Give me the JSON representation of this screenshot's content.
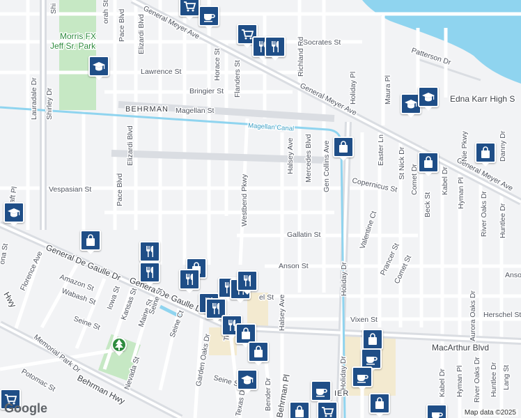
{
  "attribution": "Map data ©2025",
  "logo": "Google",
  "streets": [
    {
      "id": "general-meyer-ave-1",
      "text": "General Meyer Ave"
    },
    {
      "id": "general-meyer-ave-2",
      "text": "General Meyer Ave"
    },
    {
      "id": "general-meyer-ave-3",
      "text": "General Meyer Ave"
    },
    {
      "id": "socrates-st",
      "text": "Socrates St"
    },
    {
      "id": "patterson-dr",
      "text": "Patterson Dr"
    },
    {
      "id": "lawrence-st",
      "text": "Lawrence St"
    },
    {
      "id": "bringier-st",
      "text": "Bringier St"
    },
    {
      "id": "behrman",
      "text": "BEHRMAN"
    },
    {
      "id": "magellan-st",
      "text": "Magellan St"
    },
    {
      "id": "richland-rd",
      "text": "Richland Rd"
    },
    {
      "id": "horace-st",
      "text": "Horace St"
    },
    {
      "id": "flanders-st",
      "text": "Flanders St"
    },
    {
      "id": "pace-blvd-1",
      "text": "Pace Blvd"
    },
    {
      "id": "elizardi-blvd-1",
      "text": "Elizardi Blvd"
    },
    {
      "id": "elizardi-blvd-2",
      "text": "Elizardi Blvd"
    },
    {
      "id": "pace-blvd-2",
      "text": "Pace Blvd"
    },
    {
      "id": "shirley-dr-1",
      "text": "Shirley Dr"
    },
    {
      "id": "shirley-dr-2",
      "text": "Shi"
    },
    {
      "id": "lauradale-dr",
      "text": "Lauradale Dr"
    },
    {
      "id": "vespasian-st",
      "text": "Vespasian St"
    },
    {
      "id": "westbend-pkwy",
      "text": "Westbend Pkwy"
    },
    {
      "id": "halsey-ave-1",
      "text": "Halsey Ave"
    },
    {
      "id": "mercedes-blvd",
      "text": "Mercedes Blvd"
    },
    {
      "id": "gen-collins-ave",
      "text": "Gen Collins Ave"
    },
    {
      "id": "holiday-dr-1",
      "text": "Holiday Dr"
    },
    {
      "id": "holiday-pl",
      "text": "Holiday Pl"
    },
    {
      "id": "maura-pl",
      "text": "Maura Pl"
    },
    {
      "id": "easter-ln",
      "text": "Easter Ln"
    },
    {
      "id": "st-nick-dr",
      "text": "St Nick Dr"
    },
    {
      "id": "nie-pkwy",
      "text": "Nie Pkwy"
    },
    {
      "id": "danny-dr",
      "text": "Danny Dr"
    },
    {
      "id": "copernicus-st",
      "text": "Copernicus St"
    },
    {
      "id": "gallatin-st",
      "text": "Gallatin St"
    },
    {
      "id": "anson-st",
      "text": "Anson St"
    },
    {
      "id": "anson-st-2",
      "text": "Anso"
    },
    {
      "id": "valentine-ct",
      "text": "Valentine Ct"
    },
    {
      "id": "comet-dr",
      "text": "Comet Dr"
    },
    {
      "id": "beck-st",
      "text": "Beck St"
    },
    {
      "id": "kabel-dr-1",
      "text": "Kabel Dr"
    },
    {
      "id": "hyman-pl-1",
      "text": "Hyman Pl"
    },
    {
      "id": "river-oaks-dr-1",
      "text": "River Oaks Dr"
    },
    {
      "id": "huntlee-dr-1",
      "text": "Huntlee Dr"
    },
    {
      "id": "prancer-st",
      "text": "Prancer St"
    },
    {
      "id": "comet-st",
      "text": "Comet St"
    },
    {
      "id": "aurora-oaks-dr",
      "text": "Aurora Oaks Dr"
    },
    {
      "id": "herschel-st",
      "text": "Herschel St"
    },
    {
      "id": "vixen-st",
      "text": "Vixen St"
    },
    {
      "id": "macarthur-blvd",
      "text": "MacArthur Blvd"
    },
    {
      "id": "holiday-dr-2",
      "text": "Holiday Dr"
    },
    {
      "id": "halsey-ave-2",
      "text": "Halsey Ave"
    },
    {
      "id": "kabel-dr-2",
      "text": "Kabel Dr"
    },
    {
      "id": "hyman-pl-2",
      "text": "Hyman Pl"
    },
    {
      "id": "river-oaks-dr-2",
      "text": "River Oaks Dr"
    },
    {
      "id": "huntlee-dr-2",
      "text": "Huntlee Dr"
    },
    {
      "id": "lang-st",
      "text": "Lang St"
    },
    {
      "id": "general-de-gaulle-dr-1",
      "text": "General De Gaulle Dr"
    },
    {
      "id": "general-de-gaulle-dr-2",
      "text": "General De Gaulle Dr"
    },
    {
      "id": "florence-ave",
      "text": "Florence Ave"
    },
    {
      "id": "amazon-st",
      "text": "Amazon St"
    },
    {
      "id": "wabash-st",
      "text": "Wabash St"
    },
    {
      "id": "memorial-park-dr",
      "text": "Memorial Park Dr"
    },
    {
      "id": "iowa-st",
      "text": "Iowa St"
    },
    {
      "id": "kansas-st",
      "text": "Kansas St"
    },
    {
      "id": "maine-st",
      "text": "Maine St"
    },
    {
      "id": "seine-st-1",
      "text": "Seine St"
    },
    {
      "id": "seine-st-2",
      "text": "Seine St"
    },
    {
      "id": "seine-ct",
      "text": "Seine Ct"
    },
    {
      "id": "seine-st-3",
      "text": "Seine St"
    },
    {
      "id": "garden-oaks-dr",
      "text": "Garden Oaks Dr"
    },
    {
      "id": "nevada-st",
      "text": "Nevada St"
    },
    {
      "id": "potomac-st",
      "text": "Potomac St"
    },
    {
      "id": "behrman-hwy-1",
      "text": "Behrman Hwy"
    },
    {
      "id": "behrman-hwy-2",
      "text": "Hwy"
    },
    {
      "id": "behrman-pl",
      "text": "Behrman Pl"
    },
    {
      "id": "bender-dr",
      "text": "Bender Dr"
    },
    {
      "id": "texas-dr",
      "text": "Texas Dr"
    },
    {
      "id": "tullis-dr",
      "text": "Tullis Dr"
    },
    {
      "id": "ona-st",
      "text": "ona St"
    },
    {
      "id": "craft-pl",
      "text": "aft Pl"
    },
    {
      "id": "el-st",
      "text": "el St"
    },
    {
      "id": "ier",
      "text": "IER"
    },
    {
      "id": "orah-st",
      "text": "orah St"
    }
  ],
  "pois": [
    {
      "id": "morris-park",
      "text": "Morris FX\nJeff Sr. Park"
    },
    {
      "id": "edna-karr",
      "text": "Edna Karr High S"
    },
    {
      "id": "magellan-canal",
      "text": "Magellan Canal"
    }
  ],
  "markers": [
    {
      "type": "shop",
      "icon": "shopping-cart-icon"
    },
    {
      "type": "cafe",
      "icon": "coffee-cup-icon"
    },
    {
      "type": "shop",
      "icon": "shopping-cart-icon"
    },
    {
      "type": "food",
      "icon": "fork-knife-icon"
    },
    {
      "type": "food",
      "icon": "fork-knife-icon"
    },
    {
      "type": "school",
      "icon": "graduation-cap-icon"
    },
    {
      "type": "school",
      "icon": "graduation-cap-icon"
    },
    {
      "type": "school",
      "icon": "graduation-cap-icon"
    },
    {
      "type": "shopping",
      "icon": "shopping-bag-icon"
    },
    {
      "type": "shopping",
      "icon": "shopping-bag-icon"
    },
    {
      "type": "shopping",
      "icon": "shopping-bag-icon"
    },
    {
      "type": "school",
      "icon": "graduation-cap-icon"
    },
    {
      "type": "shopping",
      "icon": "shopping-bag-icon"
    },
    {
      "type": "food",
      "icon": "fork-knife-icon"
    },
    {
      "type": "food",
      "icon": "fork-knife-icon"
    },
    {
      "type": "shopping",
      "icon": "shopping-bag-icon"
    },
    {
      "type": "food",
      "icon": "fork-knife-icon"
    },
    {
      "type": "food",
      "icon": "fork-knife-icon"
    },
    {
      "type": "food",
      "icon": "fork-knife-icon"
    },
    {
      "type": "food",
      "icon": "fork-knife-icon"
    },
    {
      "type": "food",
      "icon": "fork-knife-icon"
    },
    {
      "type": "food",
      "icon": "fork-knife-icon"
    },
    {
      "type": "food",
      "icon": "fork-knife-icon"
    },
    {
      "type": "shopping",
      "icon": "shopping-bag-icon"
    },
    {
      "type": "shopping",
      "icon": "shopping-bag-icon"
    },
    {
      "type": "shopping",
      "icon": "shopping-bag-icon"
    },
    {
      "type": "cafe",
      "icon": "coffee-cup-icon"
    },
    {
      "type": "cafe",
      "icon": "coffee-cup-icon"
    },
    {
      "type": "school",
      "icon": "graduation-cap-icon"
    },
    {
      "type": "cafe",
      "icon": "coffee-cup-icon"
    },
    {
      "type": "shopping",
      "icon": "shopping-bag-icon"
    },
    {
      "type": "shopping",
      "icon": "shopping-bag-icon"
    },
    {
      "type": "shop",
      "icon": "shopping-cart-icon"
    },
    {
      "type": "shop",
      "icon": "shopping-cart-icon"
    },
    {
      "type": "cafe",
      "icon": "coffee-cup-icon"
    },
    {
      "type": "park",
      "icon": "tree-icon"
    }
  ],
  "colors": {
    "water": "#8fd4ef",
    "park": "#c6e8c4",
    "road": "#ffffff",
    "major_road": "#dadde2",
    "canal": "#8fd4ef",
    "marker": "#1f4e87",
    "commercial": "#f3ead0"
  }
}
